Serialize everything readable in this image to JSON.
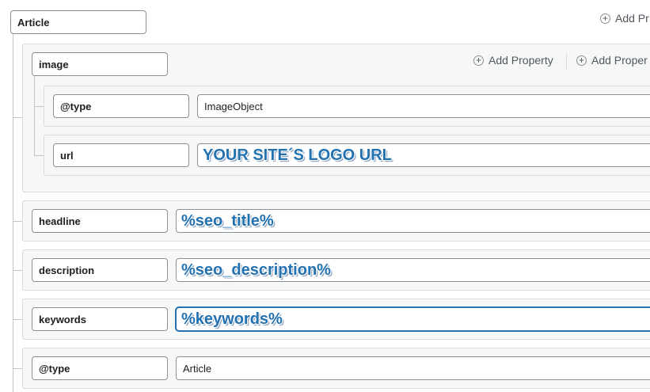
{
  "root": {
    "key": "Article",
    "add_property": "Add Pr"
  },
  "image_group": {
    "key": "image",
    "add_property_1": "Add Property",
    "add_property_2": "Add Proper",
    "rows": [
      {
        "key": "@type",
        "value": "ImageObject"
      },
      {
        "key": "url",
        "value": "YOUR SITE´S LOGO URL"
      }
    ]
  },
  "rows": [
    {
      "key": "headline",
      "value": "%seo_title%"
    },
    {
      "key": "description",
      "value": "%seo_description%"
    },
    {
      "key": "keywords",
      "value": "%keywords%"
    },
    {
      "key": "@type",
      "value": "Article"
    }
  ],
  "icons": {
    "add": "plus-circle-icon"
  },
  "colors": {
    "accent": "#2271b1",
    "panel": "#f6f7f7",
    "border": "#8c8f94"
  }
}
